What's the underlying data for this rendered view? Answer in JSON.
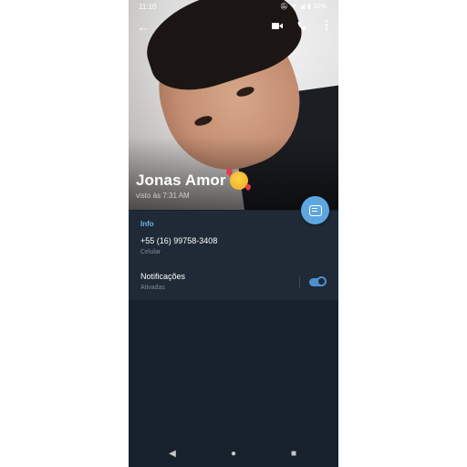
{
  "status_bar": {
    "time": "11:10",
    "battery": "52%"
  },
  "contact": {
    "name": "Jonas Amor",
    "last_seen": "visto às 7:31 AM"
  },
  "info": {
    "section_title": "Info",
    "phone_number": "+55 (16) 99758-3408",
    "phone_label": "Celular"
  },
  "notifications": {
    "title": "Notificações",
    "status": "Ativadas",
    "enabled": true
  },
  "icons": {
    "back": "arrow-left-icon",
    "video": "video-camera-icon",
    "call": "phone-icon",
    "menu": "more-vertical-icon",
    "message": "message-icon"
  },
  "colors": {
    "background": "#17212b",
    "card": "#1f2a36",
    "accent": "#5ea6e0",
    "link": "#6bb3ea"
  }
}
